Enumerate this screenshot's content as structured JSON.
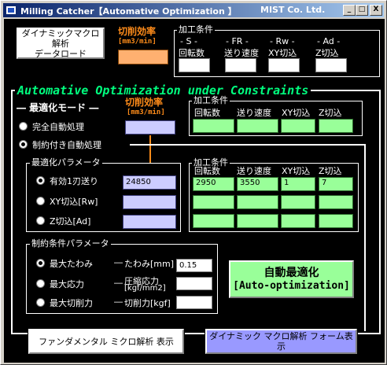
{
  "window": {
    "title": "Milling Catcher【Automative Optimization 】",
    "company": "MIST Co. Ltd.",
    "controls": {
      "minimize": "_",
      "maximize": "□",
      "close": "X"
    }
  },
  "top": {
    "dyn_download_line1": "ダイナミックマクロ解析",
    "dyn_download_line2": "データロード",
    "efficiency_label": "切削効率",
    "efficiency_unit": "[mm3/min]",
    "cond_frame": "加工条件",
    "cond_headers": [
      {
        "line1": "- S -",
        "line2": "回転数"
      },
      {
        "line1": "- FR -",
        "line2": "送り速度"
      },
      {
        "line1": "- Rw -",
        "line2": "XY切込"
      },
      {
        "line1": "- Ad -",
        "line2": "Z切込"
      }
    ]
  },
  "opt": {
    "title": "Automative  Optimization under Constraints",
    "mode_label": "― 最適化モード ―",
    "efficiency_label": "切削効率",
    "efficiency_unit": "[mm3/min]",
    "cond_frame1": "加工条件",
    "cond_headers": [
      "回転数",
      "送り速度",
      "XY切込",
      "Z切込"
    ],
    "mode_full": "完全自動処理",
    "mode_constrained": "制約付き自動処理",
    "param_frame": "最適化パラメータ",
    "param_items": [
      "有効1刃送り",
      "XY切込[Rw]",
      "Z切込[Ad]"
    ],
    "param_value": "24850",
    "cond_frame2": "加工条件",
    "result_values": [
      "2950",
      "3550",
      "1",
      "7"
    ],
    "constraint_frame": "制約条件パラメータ",
    "constraint_items": [
      "最大たわみ",
      "最大応力",
      "最大切削力"
    ],
    "constraint_labels": [
      "たわみ[mm]",
      "圧縮応力",
      "[kgf/mm2]",
      "切削力[kgf]"
    ],
    "deflection_value": "0.15",
    "auto_btn_line1": "自動最適化",
    "auto_btn_line2": "[Auto-optimization]"
  },
  "bottom": {
    "fundamental_btn": "ファンダメンタル ミクロ解析  表示",
    "dynamic_btn": "ダイナミック マクロ解析  フォーム表示"
  },
  "colors": {
    "green_title": "#00ff7f",
    "orange": "#ff8c1a",
    "field_green": "#99ff99",
    "field_lavender": "#ccccff",
    "auto_btn_bg": "#99ff99",
    "dyn_btn_bg": "#9999ff"
  }
}
